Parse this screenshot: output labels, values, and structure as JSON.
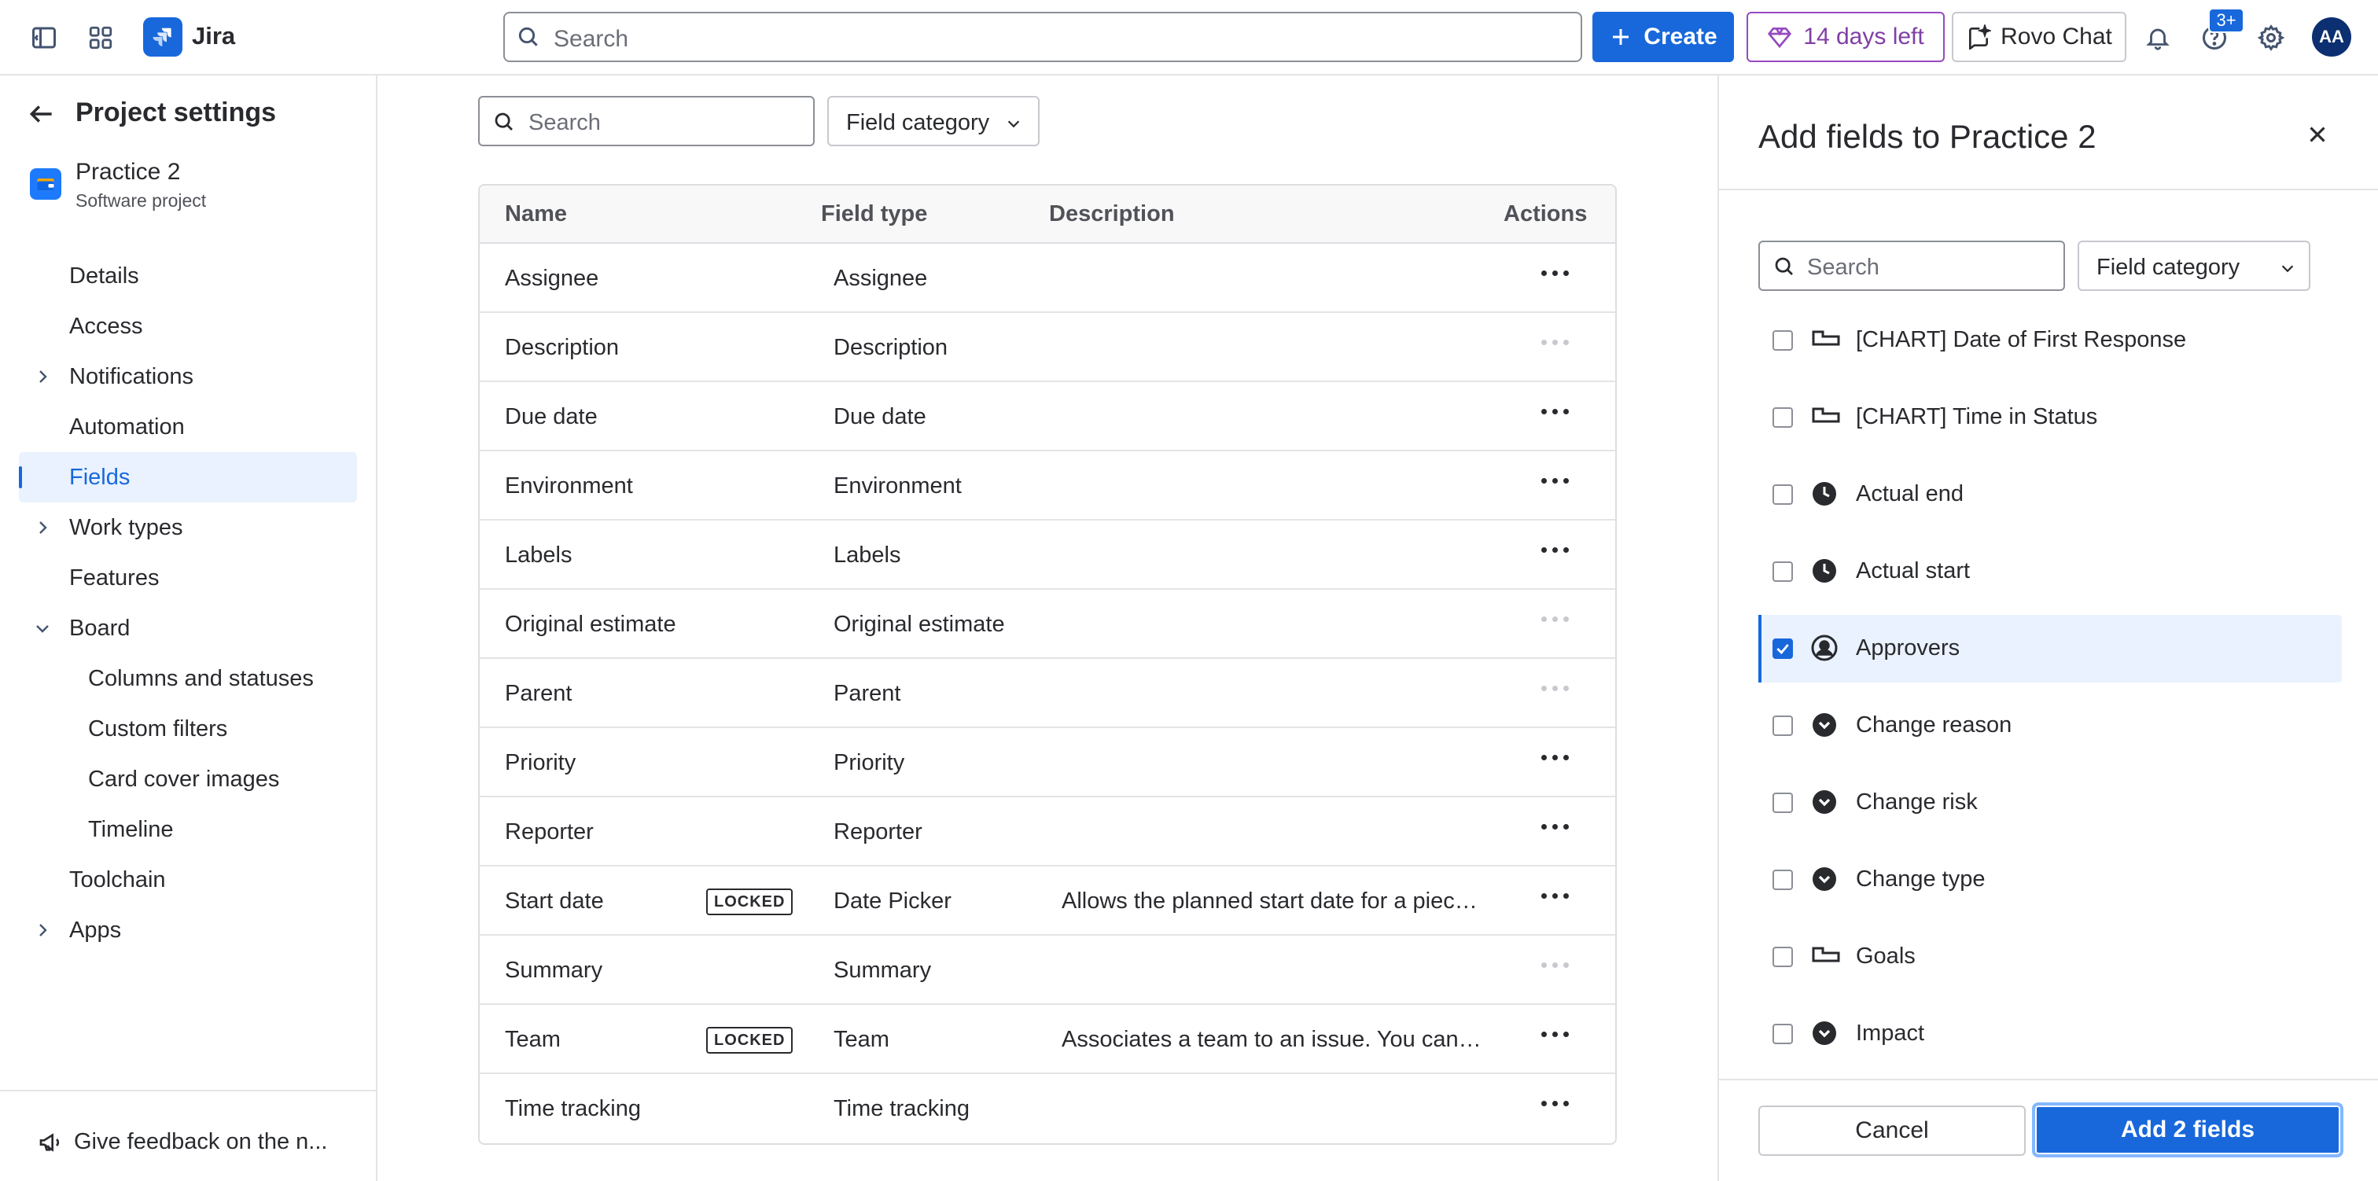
{
  "topbar": {
    "app_name": "Jira",
    "search_placeholder": "Search",
    "create_label": "Create",
    "trial_label": "14 days left",
    "rovo_label": "Rovo Chat",
    "notification_badge": "3+",
    "avatar_initials": "AA",
    "accent_color": "#1868db",
    "trial_color": "#803fa5"
  },
  "sidebar": {
    "title": "Project settings",
    "project_name": "Practice 2",
    "project_type": "Software project",
    "items": [
      {
        "label": "Details"
      },
      {
        "label": "Access"
      },
      {
        "label": "Notifications"
      },
      {
        "label": "Automation"
      },
      {
        "label": "Fields"
      },
      {
        "label": "Work types"
      },
      {
        "label": "Features"
      },
      {
        "label": "Board"
      },
      {
        "label": "Columns and statuses"
      },
      {
        "label": "Custom filters"
      },
      {
        "label": "Card cover images"
      },
      {
        "label": "Timeline"
      },
      {
        "label": "Toolchain"
      },
      {
        "label": "Apps"
      }
    ],
    "feedback_label": "Give feedback on the n..."
  },
  "main": {
    "search_placeholder": "Search",
    "category_label": "Field category",
    "columns": {
      "name": "Name",
      "type": "Field type",
      "desc": "Description",
      "actions": "Actions"
    },
    "locked_label": "LOCKED",
    "rows": [
      {
        "name": "Assignee",
        "type": "Assignee",
        "desc": ""
      },
      {
        "name": "Description",
        "type": "Description",
        "desc": ""
      },
      {
        "name": "Due date",
        "type": "Due date",
        "desc": ""
      },
      {
        "name": "Environment",
        "type": "Environment",
        "desc": ""
      },
      {
        "name": "Labels",
        "type": "Labels",
        "desc": ""
      },
      {
        "name": "Original estimate",
        "type": "Original estimate",
        "desc": ""
      },
      {
        "name": "Parent",
        "type": "Parent",
        "desc": ""
      },
      {
        "name": "Priority",
        "type": "Priority",
        "desc": ""
      },
      {
        "name": "Reporter",
        "type": "Reporter",
        "desc": ""
      },
      {
        "name": "Start date",
        "type": "Date Picker",
        "desc": "Allows the planned start date for a piece of work to be set."
      },
      {
        "name": "Summary",
        "type": "Summary",
        "desc": ""
      },
      {
        "name": "Team",
        "type": "Team",
        "desc": "Associates a team to an issue. You can use this field to search and filter issues by team."
      },
      {
        "name": "Time tracking",
        "type": "Time tracking",
        "desc": ""
      }
    ]
  },
  "panel": {
    "title": "Add fields to Practice 2",
    "search_placeholder": "Search",
    "category_label": "Field category",
    "fields": [
      {
        "label": "[CHART] Date of First Response",
        "icon": "field-tag-icon"
      },
      {
        "label": "[CHART] Time in Status",
        "icon": "field-tag-icon"
      },
      {
        "label": "Actual end",
        "icon": "clock-icon"
      },
      {
        "label": "Actual start",
        "icon": "clock-icon"
      },
      {
        "label": "Approvers",
        "icon": "people-icon"
      },
      {
        "label": "Change reason",
        "icon": "dropdown-icon"
      },
      {
        "label": "Change risk",
        "icon": "dropdown-icon"
      },
      {
        "label": "Change type",
        "icon": "dropdown-icon"
      },
      {
        "label": "Goals",
        "icon": "field-tag-icon"
      },
      {
        "label": "Impact",
        "icon": "dropdown-icon"
      }
    ],
    "cancel_label": "Cancel",
    "add_label": "Add 2 fields"
  }
}
